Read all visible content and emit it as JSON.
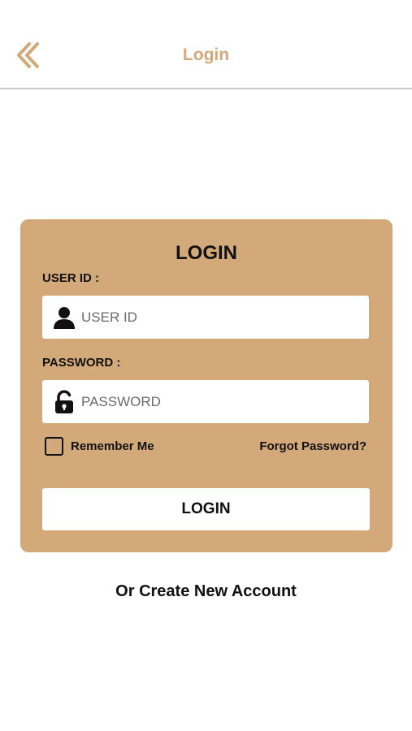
{
  "header": {
    "title": "Login",
    "back_icon": "double-chevron-left-icon",
    "accent_color": "#d4a97a"
  },
  "form": {
    "title": "LOGIN",
    "background_color": "#d4a97a",
    "user_id": {
      "label": "USER ID :",
      "placeholder": "USER ID",
      "value": "",
      "icon": "user-icon"
    },
    "password": {
      "label": "PASSWORD :",
      "placeholder": "PASSWORD",
      "value": "",
      "icon": "unlocked-padlock-icon"
    },
    "remember_me": {
      "label": "Remember Me",
      "checked": false
    },
    "forgot_password_label": "Forgot Password?",
    "login_button_label": "LOGIN"
  },
  "footer": {
    "create_account_label": "Or Create New Account"
  }
}
